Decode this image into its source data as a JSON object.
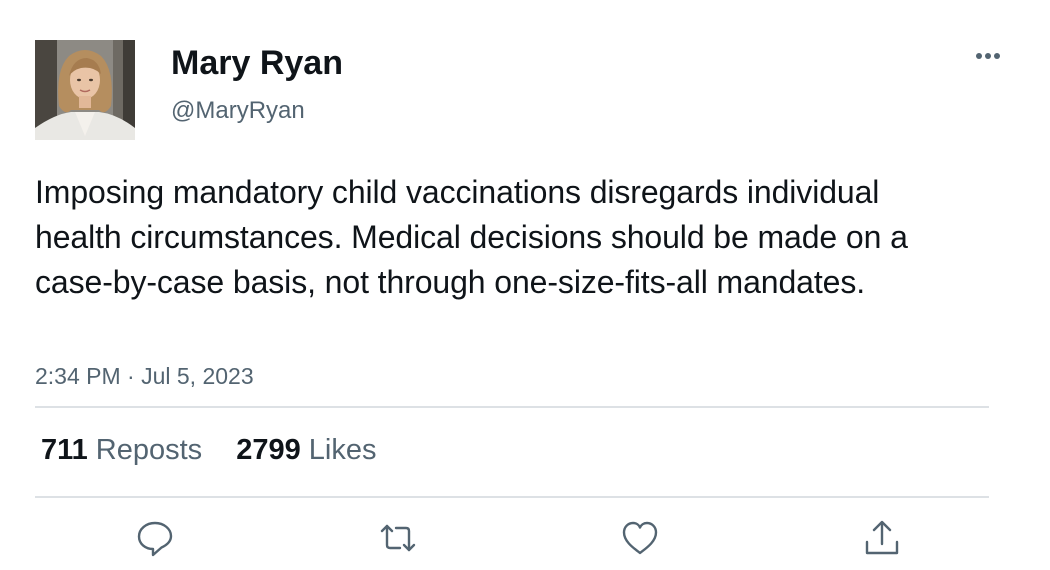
{
  "author": {
    "name": "Mary Ryan",
    "handle": "@MaryRyan",
    "avatar_icon": "profile-photo"
  },
  "tweet": {
    "text": "Imposing mandatory child vaccinations disregards individual health circumstances. Medical decisions should be made on a case-by-case basis, not through one-size-fits-all mandates.",
    "timestamp": "2:34 PM · Jul 5, 2023"
  },
  "stats": {
    "reposts_count": "711",
    "reposts_label": "Reposts",
    "likes_count": "2799",
    "likes_label": "Likes"
  },
  "actions": [
    {
      "icon": "reply-icon"
    },
    {
      "icon": "repost-icon"
    },
    {
      "icon": "like-icon"
    },
    {
      "icon": "share-icon"
    }
  ],
  "colors": {
    "text_primary": "#0f1419",
    "text_secondary": "#536471",
    "icon": "#536471",
    "divider": "#dde1e5",
    "background": "#ffffff"
  }
}
